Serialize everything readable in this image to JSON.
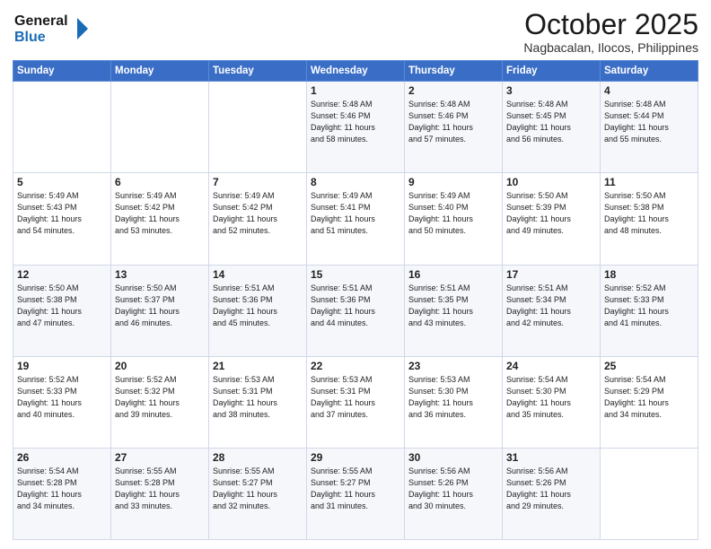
{
  "header": {
    "logo_line1": "General",
    "logo_line2": "Blue",
    "month": "October 2025",
    "location": "Nagbacalan, Ilocos, Philippines"
  },
  "weekdays": [
    "Sunday",
    "Monday",
    "Tuesday",
    "Wednesday",
    "Thursday",
    "Friday",
    "Saturday"
  ],
  "weeks": [
    [
      {
        "day": "",
        "info": ""
      },
      {
        "day": "",
        "info": ""
      },
      {
        "day": "",
        "info": ""
      },
      {
        "day": "1",
        "info": "Sunrise: 5:48 AM\nSunset: 5:46 PM\nDaylight: 11 hours\nand 58 minutes."
      },
      {
        "day": "2",
        "info": "Sunrise: 5:48 AM\nSunset: 5:46 PM\nDaylight: 11 hours\nand 57 minutes."
      },
      {
        "day": "3",
        "info": "Sunrise: 5:48 AM\nSunset: 5:45 PM\nDaylight: 11 hours\nand 56 minutes."
      },
      {
        "day": "4",
        "info": "Sunrise: 5:48 AM\nSunset: 5:44 PM\nDaylight: 11 hours\nand 55 minutes."
      }
    ],
    [
      {
        "day": "5",
        "info": "Sunrise: 5:49 AM\nSunset: 5:43 PM\nDaylight: 11 hours\nand 54 minutes."
      },
      {
        "day": "6",
        "info": "Sunrise: 5:49 AM\nSunset: 5:42 PM\nDaylight: 11 hours\nand 53 minutes."
      },
      {
        "day": "7",
        "info": "Sunrise: 5:49 AM\nSunset: 5:42 PM\nDaylight: 11 hours\nand 52 minutes."
      },
      {
        "day": "8",
        "info": "Sunrise: 5:49 AM\nSunset: 5:41 PM\nDaylight: 11 hours\nand 51 minutes."
      },
      {
        "day": "9",
        "info": "Sunrise: 5:49 AM\nSunset: 5:40 PM\nDaylight: 11 hours\nand 50 minutes."
      },
      {
        "day": "10",
        "info": "Sunrise: 5:50 AM\nSunset: 5:39 PM\nDaylight: 11 hours\nand 49 minutes."
      },
      {
        "day": "11",
        "info": "Sunrise: 5:50 AM\nSunset: 5:38 PM\nDaylight: 11 hours\nand 48 minutes."
      }
    ],
    [
      {
        "day": "12",
        "info": "Sunrise: 5:50 AM\nSunset: 5:38 PM\nDaylight: 11 hours\nand 47 minutes."
      },
      {
        "day": "13",
        "info": "Sunrise: 5:50 AM\nSunset: 5:37 PM\nDaylight: 11 hours\nand 46 minutes."
      },
      {
        "day": "14",
        "info": "Sunrise: 5:51 AM\nSunset: 5:36 PM\nDaylight: 11 hours\nand 45 minutes."
      },
      {
        "day": "15",
        "info": "Sunrise: 5:51 AM\nSunset: 5:36 PM\nDaylight: 11 hours\nand 44 minutes."
      },
      {
        "day": "16",
        "info": "Sunrise: 5:51 AM\nSunset: 5:35 PM\nDaylight: 11 hours\nand 43 minutes."
      },
      {
        "day": "17",
        "info": "Sunrise: 5:51 AM\nSunset: 5:34 PM\nDaylight: 11 hours\nand 42 minutes."
      },
      {
        "day": "18",
        "info": "Sunrise: 5:52 AM\nSunset: 5:33 PM\nDaylight: 11 hours\nand 41 minutes."
      }
    ],
    [
      {
        "day": "19",
        "info": "Sunrise: 5:52 AM\nSunset: 5:33 PM\nDaylight: 11 hours\nand 40 minutes."
      },
      {
        "day": "20",
        "info": "Sunrise: 5:52 AM\nSunset: 5:32 PM\nDaylight: 11 hours\nand 39 minutes."
      },
      {
        "day": "21",
        "info": "Sunrise: 5:53 AM\nSunset: 5:31 PM\nDaylight: 11 hours\nand 38 minutes."
      },
      {
        "day": "22",
        "info": "Sunrise: 5:53 AM\nSunset: 5:31 PM\nDaylight: 11 hours\nand 37 minutes."
      },
      {
        "day": "23",
        "info": "Sunrise: 5:53 AM\nSunset: 5:30 PM\nDaylight: 11 hours\nand 36 minutes."
      },
      {
        "day": "24",
        "info": "Sunrise: 5:54 AM\nSunset: 5:30 PM\nDaylight: 11 hours\nand 35 minutes."
      },
      {
        "day": "25",
        "info": "Sunrise: 5:54 AM\nSunset: 5:29 PM\nDaylight: 11 hours\nand 34 minutes."
      }
    ],
    [
      {
        "day": "26",
        "info": "Sunrise: 5:54 AM\nSunset: 5:28 PM\nDaylight: 11 hours\nand 34 minutes."
      },
      {
        "day": "27",
        "info": "Sunrise: 5:55 AM\nSunset: 5:28 PM\nDaylight: 11 hours\nand 33 minutes."
      },
      {
        "day": "28",
        "info": "Sunrise: 5:55 AM\nSunset: 5:27 PM\nDaylight: 11 hours\nand 32 minutes."
      },
      {
        "day": "29",
        "info": "Sunrise: 5:55 AM\nSunset: 5:27 PM\nDaylight: 11 hours\nand 31 minutes."
      },
      {
        "day": "30",
        "info": "Sunrise: 5:56 AM\nSunset: 5:26 PM\nDaylight: 11 hours\nand 30 minutes."
      },
      {
        "day": "31",
        "info": "Sunrise: 5:56 AM\nSunset: 5:26 PM\nDaylight: 11 hours\nand 29 minutes."
      },
      {
        "day": "",
        "info": ""
      }
    ]
  ]
}
